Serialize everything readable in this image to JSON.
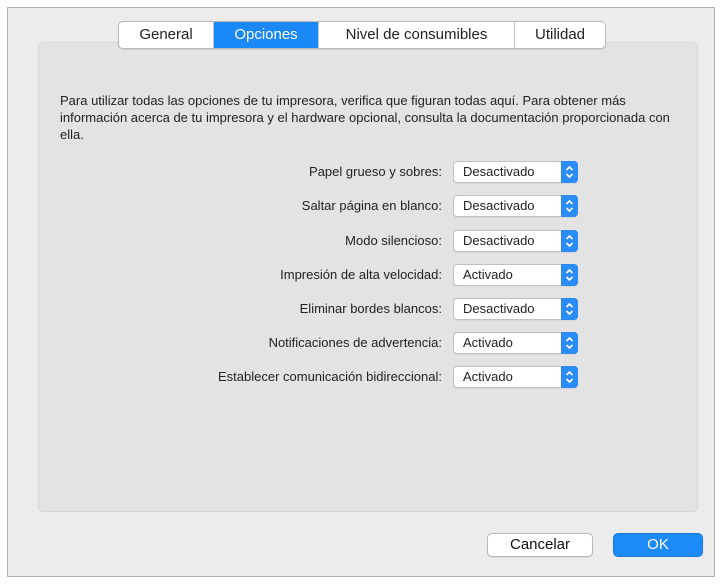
{
  "tabs": [
    {
      "label": "General",
      "active": false
    },
    {
      "label": "Opciones",
      "active": true
    },
    {
      "label": "Nivel de consumibles",
      "active": false
    },
    {
      "label": "Utilidad",
      "active": false
    }
  ],
  "description": "Para utilizar todas las opciones de tu impresora, verifica que figuran todas aquí. Para obtener más información acerca de tu impresora y el hardware opcional, consulta la documentación proporcionada con ella.",
  "options": [
    {
      "label": "Papel grueso y sobres:",
      "value": "Desactivado"
    },
    {
      "label": "Saltar página en blanco:",
      "value": "Desactivado"
    },
    {
      "label": "Modo silencioso:",
      "value": "Desactivado"
    },
    {
      "label": "Impresión de alta velocidad:",
      "value": "Activado"
    },
    {
      "label": "Eliminar bordes blancos:",
      "value": "Desactivado"
    },
    {
      "label": "Notificaciones de advertencia:",
      "value": "Activado"
    },
    {
      "label": "Establecer comunicación bidireccional:",
      "value": "Activado"
    }
  ],
  "buttons": {
    "cancel_label": "Cancelar",
    "ok_label": "OK"
  },
  "colors": {
    "accent": "#1a88f6"
  },
  "icons": {
    "popup_arrow": "chevron-up-down-icon"
  }
}
